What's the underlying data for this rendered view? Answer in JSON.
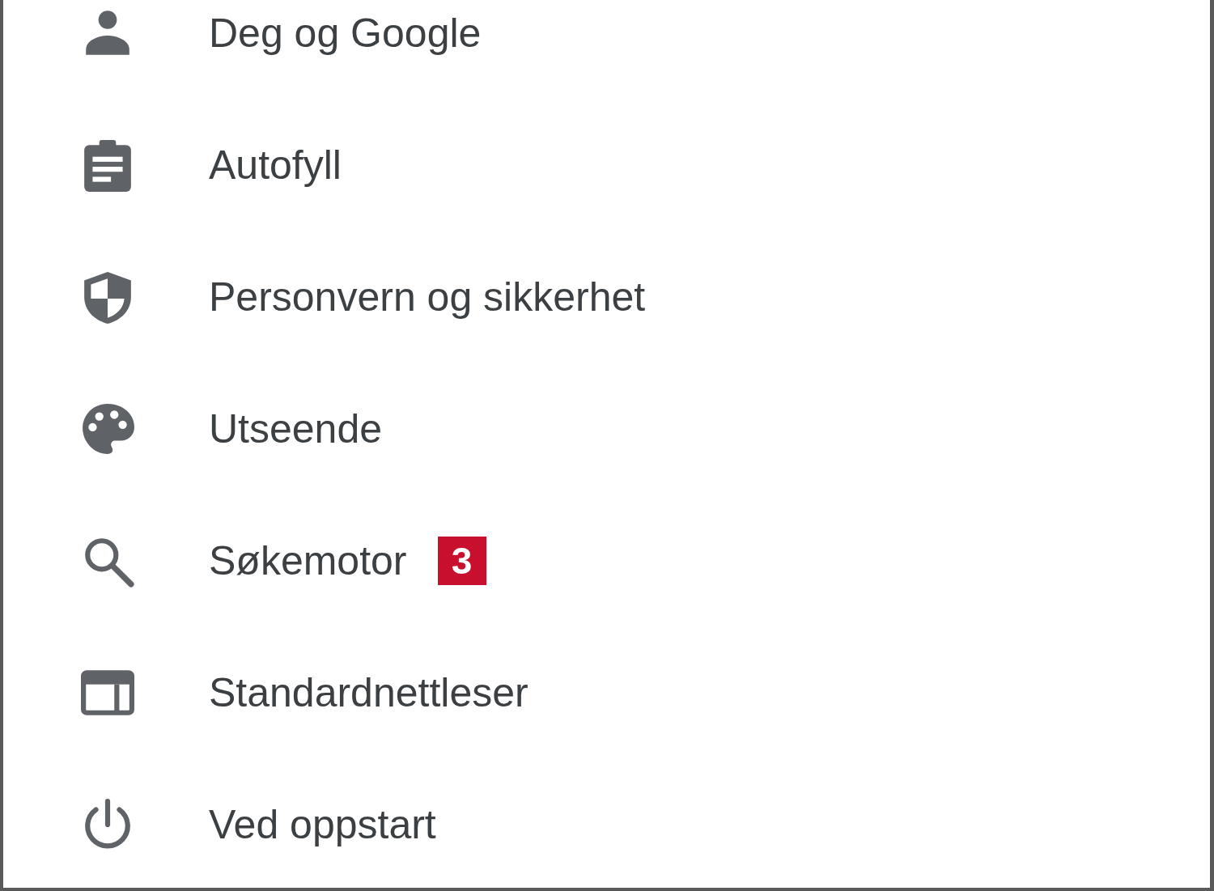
{
  "menu": [
    {
      "label": "Deg og Google"
    },
    {
      "label": "Autofyll"
    },
    {
      "label": "Personvern og sikkerhet"
    },
    {
      "label": "Utseende"
    },
    {
      "label": "Søkemotor",
      "badge": "3"
    },
    {
      "label": "Standardnettleser"
    },
    {
      "label": "Ved oppstart"
    }
  ]
}
